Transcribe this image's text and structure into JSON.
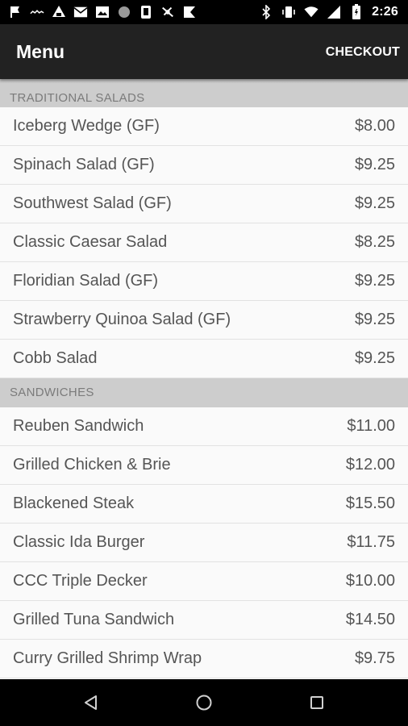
{
  "status_bar": {
    "time": "2:26",
    "left_icons": [
      "flag-icon",
      "voicemail-icon",
      "network-icon",
      "mail-icon",
      "image-icon",
      "circle-icon",
      "device-icon",
      "satellite-icon",
      "shield-icon"
    ],
    "right_icons": [
      "bluetooth-icon",
      "vibrate-icon",
      "wifi-icon",
      "signal-icon",
      "battery-icon"
    ]
  },
  "app_bar": {
    "title": "Menu",
    "action_label": "CHECKOUT"
  },
  "sections": [
    {
      "header": "TRADITIONAL SALADS",
      "items": [
        {
          "name": "Iceberg Wedge (GF)",
          "price": "$8.00"
        },
        {
          "name": "Spinach Salad (GF)",
          "price": "$9.25"
        },
        {
          "name": "Southwest Salad (GF)",
          "price": "$9.25"
        },
        {
          "name": "Classic Caesar Salad",
          "price": "$8.25"
        },
        {
          "name": "Floridian Salad (GF)",
          "price": "$9.25"
        },
        {
          "name": "Strawberry Quinoa Salad (GF)",
          "price": "$9.25"
        },
        {
          "name": "Cobb Salad",
          "price": "$9.25"
        }
      ]
    },
    {
      "header": "SANDWICHES",
      "items": [
        {
          "name": "Reuben Sandwich",
          "price": "$11.00"
        },
        {
          "name": "Grilled Chicken & Brie",
          "price": "$12.00"
        },
        {
          "name": "Blackened Steak",
          "price": "$15.50"
        },
        {
          "name": "Classic Ida Burger",
          "price": "$11.75"
        },
        {
          "name": "CCC Triple Decker",
          "price": "$10.00"
        },
        {
          "name": "Grilled Tuna Sandwich",
          "price": "$14.50"
        },
        {
          "name": "Curry Grilled Shrimp Wrap",
          "price": "$9.75"
        }
      ]
    }
  ],
  "nav_bar": {
    "buttons": [
      "back-icon",
      "home-icon",
      "recents-icon"
    ]
  }
}
